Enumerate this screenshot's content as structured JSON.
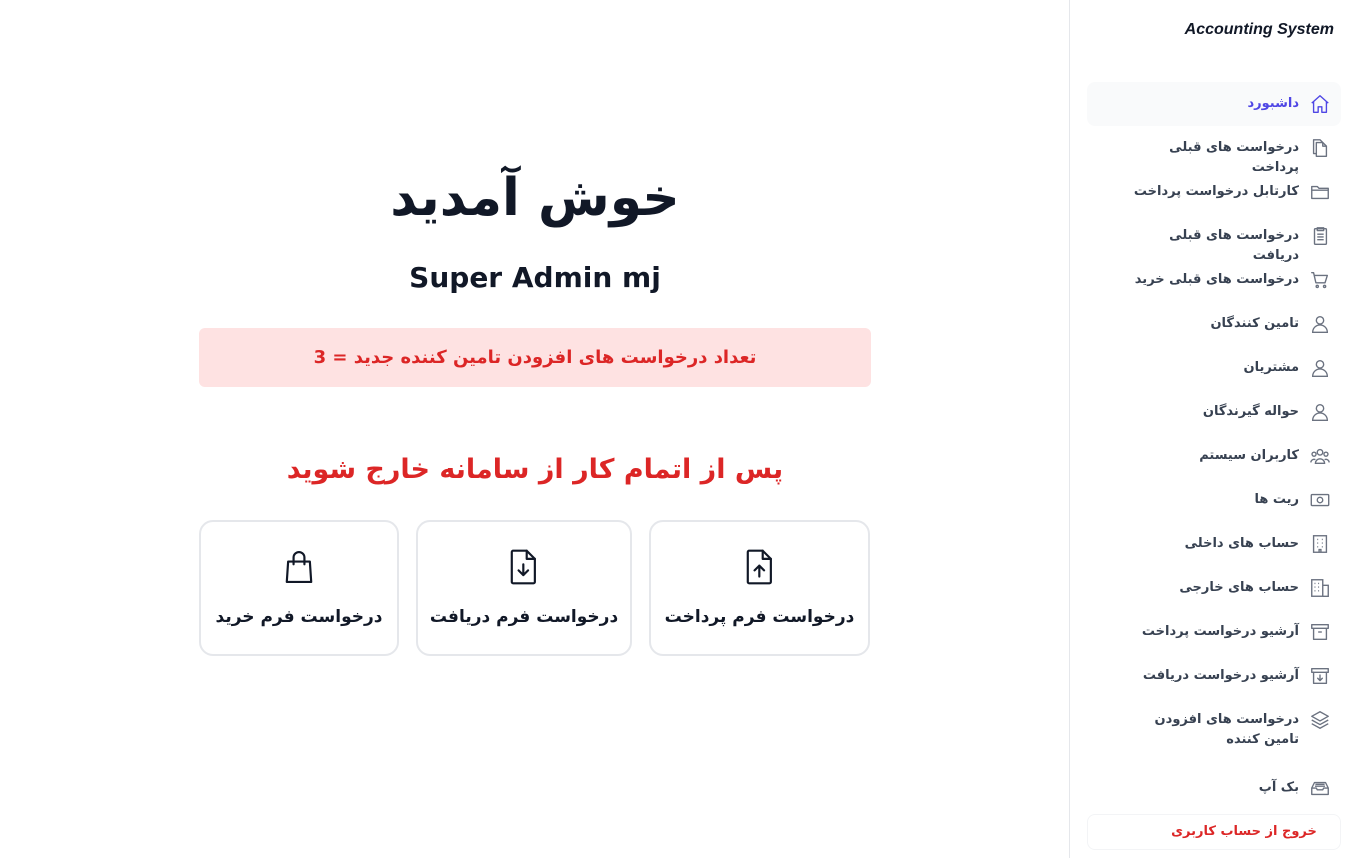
{
  "sidebar": {
    "brand": "Accounting System",
    "items": [
      {
        "label": "داشبورد",
        "icon": "home-icon",
        "active": true
      },
      {
        "label": "درخواست های قبلی پرداخت",
        "icon": "documents-icon"
      },
      {
        "label": "کارتابل درخواست پرداخت",
        "icon": "folder-icon"
      },
      {
        "label": "درخواست های قبلی دریافت",
        "icon": "clipboard-icon"
      },
      {
        "label": "درخواست های قبلی خرید",
        "icon": "cart-icon"
      },
      {
        "label": "تامین کنندگان",
        "icon": "user-icon"
      },
      {
        "label": "مشتریان",
        "icon": "user-icon"
      },
      {
        "label": "حواله گیرندگان",
        "icon": "user-icon"
      },
      {
        "label": "کاربران سیستم",
        "icon": "users-icon"
      },
      {
        "label": "ریت ها",
        "icon": "cash-icon"
      },
      {
        "label": "حساب های داخلی",
        "icon": "building-icon"
      },
      {
        "label": "حساب های خارجی",
        "icon": "office-building-icon"
      },
      {
        "label": "آرشیو درخواست پرداخت",
        "icon": "archive-icon"
      },
      {
        "label": "آرشیو درخواست دریافت",
        "icon": "archive-download-icon"
      },
      {
        "label": "درخواست های افزودن تامین کننده",
        "icon": "layers-icon"
      },
      {
        "label": "بک آپ",
        "icon": "inbox-stack-icon"
      }
    ],
    "logout": "خروج از حساب کاربری"
  },
  "main": {
    "welcome": "خوش آمدید",
    "username": "Super Admin mj",
    "alert": "تعداد درخواست های افزودن تامین کننده جدید = 3",
    "notice": "پس از اتمام کار از سامانه خارج شوید",
    "cards": [
      {
        "label": "درخواست فرم پرداخت",
        "icon": "document-upload-icon"
      },
      {
        "label": "درخواست فرم دریافت",
        "icon": "document-download-icon"
      },
      {
        "label": "درخواست فرم خرید",
        "icon": "shopping-bag-icon"
      }
    ]
  },
  "colors": {
    "accent": "#4f46e5",
    "danger": "#dc2626",
    "alert_bg": "#fee2e2",
    "border": "#e5e7eb"
  }
}
